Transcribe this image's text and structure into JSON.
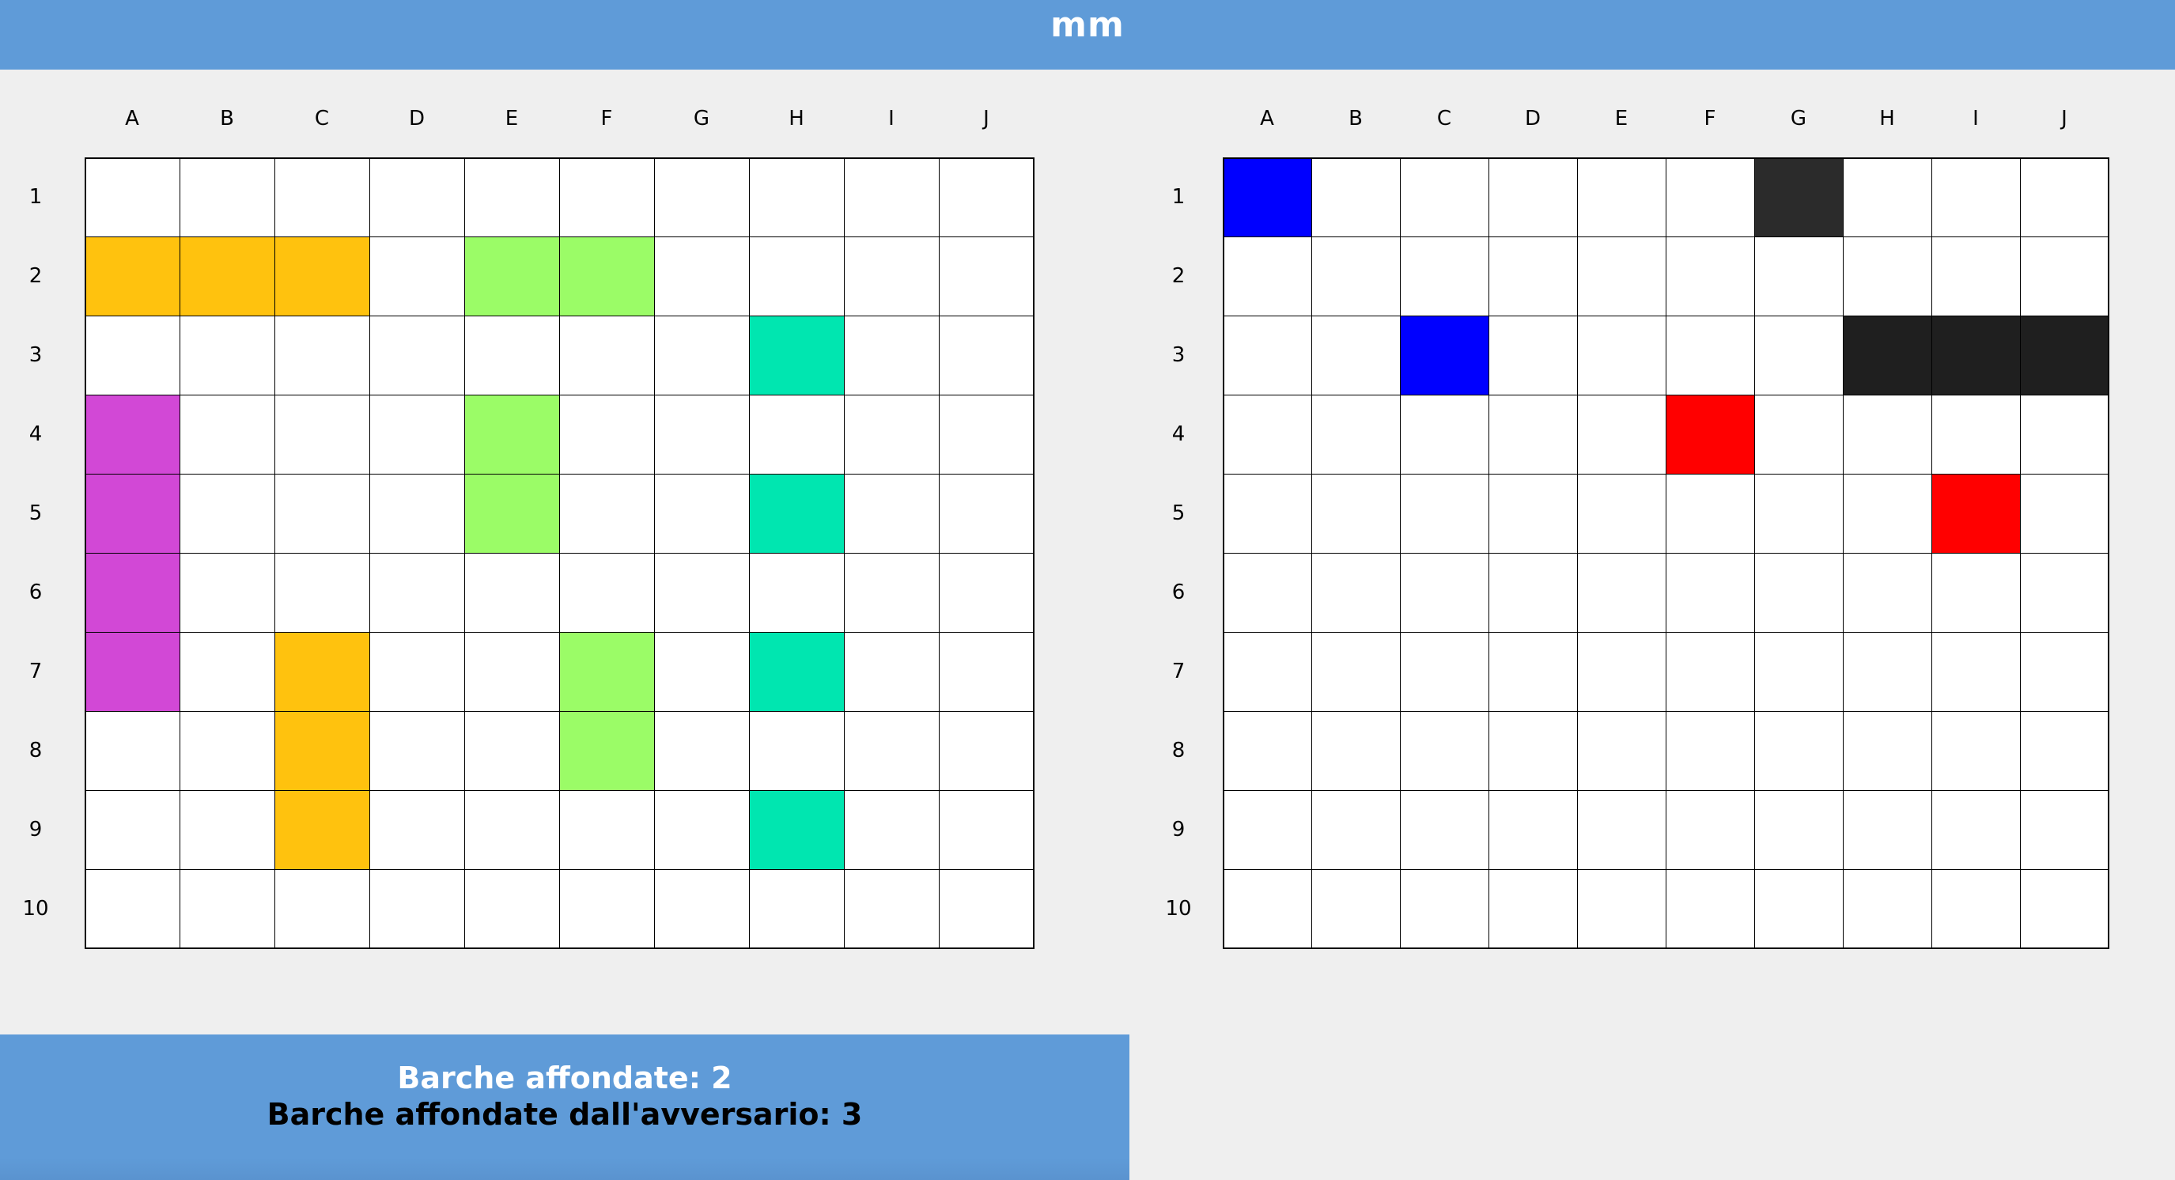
{
  "header": {
    "title": "mm"
  },
  "columns": [
    "A",
    "B",
    "C",
    "D",
    "E",
    "F",
    "G",
    "H",
    "I",
    "J"
  ],
  "rows": [
    "1",
    "2",
    "3",
    "4",
    "5",
    "6",
    "7",
    "8",
    "9",
    "10"
  ],
  "colors": {
    "empty": "#ffffff",
    "yellow": "#ffc20e",
    "green": "#9bfc67",
    "teal": "#00e6b0",
    "magenta": "#d248d6",
    "miss": "#0000ff",
    "hit": "#ff0000",
    "sunk": "#1f1f1f",
    "sunk_alt": "#2b2b2b"
  },
  "player_board": {
    "name": "player-board",
    "ships": [
      {
        "color_key": "yellow",
        "cells": [
          "A2",
          "B2",
          "C2"
        ]
      },
      {
        "color_key": "green",
        "cells": [
          "E2",
          "F2"
        ]
      },
      {
        "color_key": "teal",
        "cells": [
          "H3"
        ]
      },
      {
        "color_key": "magenta",
        "cells": [
          "A4",
          "A5",
          "A6",
          "A7"
        ]
      },
      {
        "color_key": "green",
        "cells": [
          "E4",
          "E5"
        ]
      },
      {
        "color_key": "teal",
        "cells": [
          "H5"
        ]
      },
      {
        "color_key": "yellow",
        "cells": [
          "C7",
          "C8",
          "C9"
        ]
      },
      {
        "color_key": "green",
        "cells": [
          "F7",
          "F8"
        ]
      },
      {
        "color_key": "teal",
        "cells": [
          "H7"
        ]
      },
      {
        "color_key": "teal",
        "cells": [
          "H9"
        ]
      }
    ]
  },
  "opponent_board": {
    "name": "opponent-board",
    "marks": [
      {
        "state": "miss",
        "color_key": "miss",
        "cells": [
          "A1",
          "C3"
        ]
      },
      {
        "state": "sunk",
        "color_key": "sunk_alt",
        "cells": [
          "G1"
        ]
      },
      {
        "state": "sunk",
        "color_key": "sunk",
        "cells": [
          "H3",
          "I3",
          "J3"
        ]
      },
      {
        "state": "hit",
        "color_key": "hit",
        "cells": [
          "F4",
          "I5"
        ]
      }
    ]
  },
  "stats": {
    "own_sunk": "Barche affondate: 2",
    "opponent_sunk": "Barche affondate dall'avversario: 3"
  }
}
